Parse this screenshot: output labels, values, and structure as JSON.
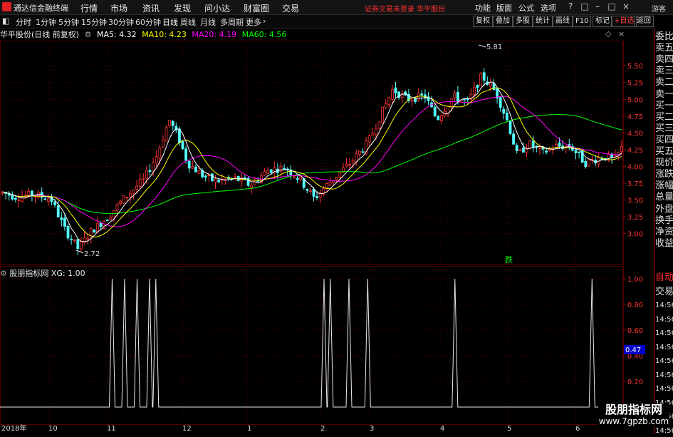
{
  "window": {
    "app_title": "通达信金融终端",
    "menus": [
      "行情",
      "市场",
      "资讯",
      "发现",
      "问小达",
      "财富圈",
      "交易"
    ],
    "notice": "证券交易未登录  华平股份",
    "right_menus": [
      "功能",
      "版面",
      "公式",
      "选项"
    ],
    "guest": "游客"
  },
  "periods": {
    "items": [
      "分时",
      "1分钟",
      "5分钟",
      "15分钟",
      "30分钟",
      "60分钟",
      "日线",
      "周线",
      "月线",
      "多周期",
      "更多"
    ],
    "active": "日线"
  },
  "tools": [
    "复权",
    "叠加",
    "多股",
    "统计",
    "画线",
    "F10",
    "标记",
    "+自选",
    "返回"
  ],
  "stock": {
    "name_line": "华平股份(日线 前复权)",
    "ma": [
      {
        "label": "MA5: 4.32",
        "color": "#ffffff"
      },
      {
        "label": "MA10: 4.23",
        "color": "#ffff00"
      },
      {
        "label": "MA20: 4.19",
        "color": "#ff00ff"
      },
      {
        "label": "MA60: 4.56",
        "color": "#00ff00"
      }
    ]
  },
  "annotations": {
    "high": "5.81",
    "low": "2.72",
    "signal": "跌"
  },
  "price_axis": [
    "5.50",
    "5.25",
    "5.00",
    "4.75",
    "4.50",
    "4.25",
    "4.00",
    "3.75",
    "3.50",
    "3.25",
    "3.00"
  ],
  "indicator": {
    "title": "股朋指标网",
    "xg": "XG: 1.00",
    "axis": [
      "1.00",
      "0.80",
      "0.60",
      "0.40",
      "0.20"
    ],
    "current": "0.47"
  },
  "dates": [
    "2018年",
    "10",
    "11",
    "12",
    "1",
    "2",
    "3",
    "4",
    "5",
    "6"
  ],
  "side_labels": [
    "委比",
    "卖五",
    "卖四",
    "卖三",
    "卖二",
    "卖一",
    "买一",
    "买二",
    "买三",
    "买四",
    "买五",
    "现价",
    "涨跌",
    "涨幅",
    "总量",
    "外盘",
    "换手",
    "净资",
    "收益",
    "自动",
    "交易",
    "14:56",
    "14:56",
    "14:56",
    "14:56",
    "14:56",
    "14:56",
    "14:56",
    "14:56",
    "14:56",
    "14:56"
  ],
  "watermark": {
    "line1": "股朋指标网",
    "line2": "www.7gpzb.com"
  },
  "colors": {
    "up": "#ff3232",
    "down": "#54ffff",
    "ma60": "#00ff00",
    "ma20": "#ff00ff",
    "ma10": "#ffff00",
    "ma5": "#ffffff",
    "accent": "#ff3030"
  },
  "signals": [
    0.18,
    0.2,
    0.22,
    0.24,
    0.25,
    0.52,
    0.53,
    0.56,
    0.59,
    0.73,
    0.95
  ]
}
